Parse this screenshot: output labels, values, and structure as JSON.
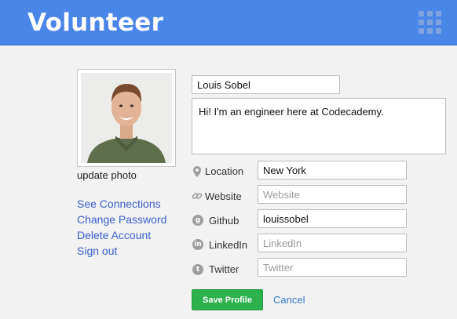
{
  "header": {
    "title": "Volunteer",
    "menu_icon": "apps-grid-icon",
    "color": "#4a86e8"
  },
  "profile": {
    "update_photo_label": "update photo",
    "name": "Louis Sobel",
    "bio": "Hi! I'm an engineer here at Codecademy."
  },
  "links": [
    "See Connections",
    "Change Password",
    "Delete Account",
    "Sign out"
  ],
  "fields": {
    "location": {
      "label": "Location",
      "value": "New York",
      "placeholder": "",
      "icon": "location-pin-icon"
    },
    "website": {
      "label": "Website",
      "value": "",
      "placeholder": "Website",
      "icon": "link-icon"
    },
    "github": {
      "label": "Github",
      "value": "louissobel",
      "placeholder": "",
      "icon": "github-icon"
    },
    "linkedin": {
      "label": "LinkedIn",
      "value": "",
      "placeholder": "LinkedIn",
      "icon": "linkedin-icon"
    },
    "twitter": {
      "label": "Twitter",
      "value": "",
      "placeholder": "Twitter",
      "icon": "twitter-icon"
    }
  },
  "actions": {
    "save_label": "Save Profile",
    "cancel_label": "Cancel",
    "save_color": "#2bb24c"
  }
}
